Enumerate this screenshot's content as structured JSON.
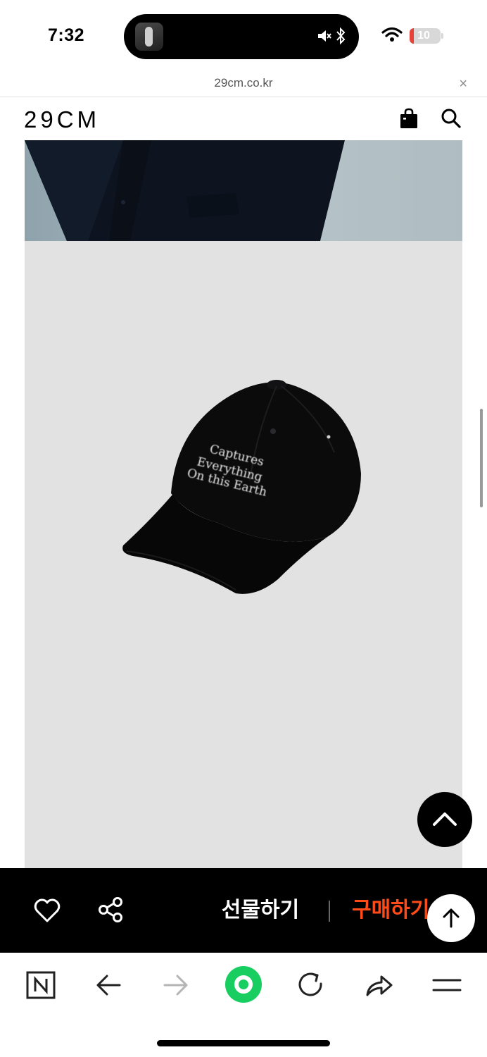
{
  "status_bar": {
    "time": "7:32",
    "battery": "10",
    "icons": [
      "muted-speaker-icon",
      "bluetooth-icon",
      "wifi-icon",
      "battery-icon"
    ]
  },
  "browser": {
    "url": "29cm.co.kr",
    "close_icon": "×"
  },
  "site_header": {
    "logo": "29CM",
    "icons": [
      "shopping-bag-icon",
      "search-icon"
    ]
  },
  "product_image": {
    "cap_text_lines": [
      "Captures",
      "Everything",
      "On this Earth"
    ]
  },
  "action_bar": {
    "gift_label": "선물하기",
    "buy_label": "구매하기",
    "icons": [
      "heart-icon",
      "share-icon"
    ]
  },
  "toolbar": {
    "icons": [
      "naver-n-icon",
      "back-arrow-icon",
      "forward-arrow-icon",
      "green-dot-icon",
      "refresh-icon",
      "share-arrow-icon",
      "menu-icon"
    ]
  },
  "colors": {
    "buy_accent": "#ff4b18",
    "green_button": "#19ce60",
    "action_bar_bg": "#000000",
    "battery_low": "#e8413a"
  }
}
